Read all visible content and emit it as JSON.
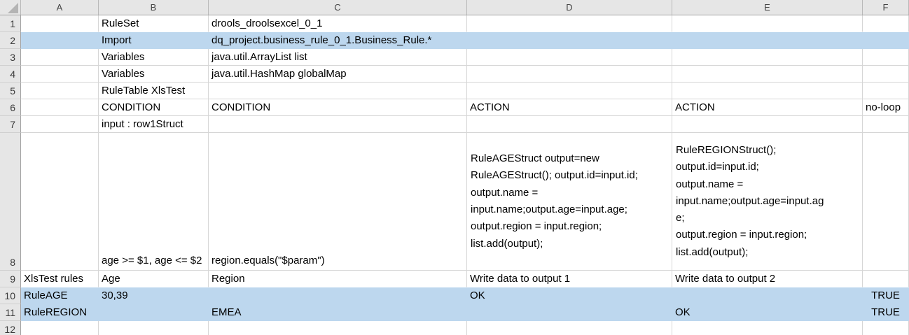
{
  "app": "spreadsheet-grid",
  "colors": {
    "highlight_fill": "#BDD7EE",
    "header_bg": "#E6E6E6",
    "gridline": "#D6D6D6",
    "header_border": "#A3A3A3",
    "cell_text": "#000000",
    "heading_text": "#444444"
  },
  "icons": {
    "select_all": "triangle-bottom-right"
  },
  "sheet": {
    "columns": [
      "A",
      "B",
      "C",
      "D",
      "E",
      "F"
    ],
    "rows": [
      {
        "n": "1",
        "cells": {
          "B": {
            "t": "RuleSet"
          },
          "C": {
            "t": "drools_droolsexcel_0_1"
          }
        }
      },
      {
        "n": "2",
        "fill": true,
        "cells": {
          "B": {
            "t": "Import"
          },
          "C": {
            "t": "dq_project.business_rule_0_1.Business_Rule.*"
          }
        }
      },
      {
        "n": "3",
        "cells": {
          "B": {
            "t": "Variables"
          },
          "C": {
            "t": "java.util.ArrayList list"
          }
        }
      },
      {
        "n": "4",
        "cells": {
          "B": {
            "t": "Variables"
          },
          "C": {
            "t": "java.util.HashMap globalMap"
          }
        }
      },
      {
        "n": "5",
        "cells": {
          "B": {
            "t": "RuleTable XlsTest"
          }
        }
      },
      {
        "n": "6",
        "cells": {
          "B": {
            "t": "CONDITION"
          },
          "C": {
            "t": "CONDITION"
          },
          "D": {
            "t": "ACTION"
          },
          "E": {
            "t": "ACTION"
          },
          "F": {
            "t": "no-loop"
          }
        }
      },
      {
        "n": "7",
        "cells": {
          "B": {
            "t": "input : row1Struct"
          }
        }
      },
      {
        "n": "8",
        "tall": true,
        "cells": {
          "B": {
            "t": "age >= $1, age <= $2",
            "valign": "bottom"
          },
          "C": {
            "t": "region.equals(\"$param\")",
            "valign": "bottom"
          },
          "D": {
            "t": "RuleAGEStruct output=new\nRuleAGEStruct(); output.id=input.id;\noutput.name =\ninput.name;output.age=input.age;\noutput.region = input.region;\nlist.add(output);",
            "multiline": true
          },
          "E": {
            "t": "RuleREGIONStruct();\noutput.id=input.id;\noutput.name =\ninput.name;output.age=input.ag\ne;\noutput.region = input.region;\nlist.add(output);",
            "multiline": true
          }
        }
      },
      {
        "n": "9",
        "cells": {
          "A": {
            "t": "XlsTest rules"
          },
          "B": {
            "t": "Age"
          },
          "C": {
            "t": "Region"
          },
          "D": {
            "t": "Write data to output 1"
          },
          "E": {
            "t": "Write data to output 2"
          }
        }
      },
      {
        "n": "10",
        "fill": true,
        "cells": {
          "A": {
            "t": "RuleAGE"
          },
          "B": {
            "t": "30,39"
          },
          "D": {
            "t": "OK"
          },
          "F": {
            "t": "TRUE",
            "align": "center"
          }
        }
      },
      {
        "n": "11",
        "fill": true,
        "cells": {
          "A": {
            "t": "RuleREGION"
          },
          "C": {
            "t": "EMEA"
          },
          "E": {
            "t": "OK"
          },
          "F": {
            "t": "TRUE",
            "align": "center"
          }
        }
      },
      {
        "n": "12",
        "cells": {}
      }
    ]
  }
}
